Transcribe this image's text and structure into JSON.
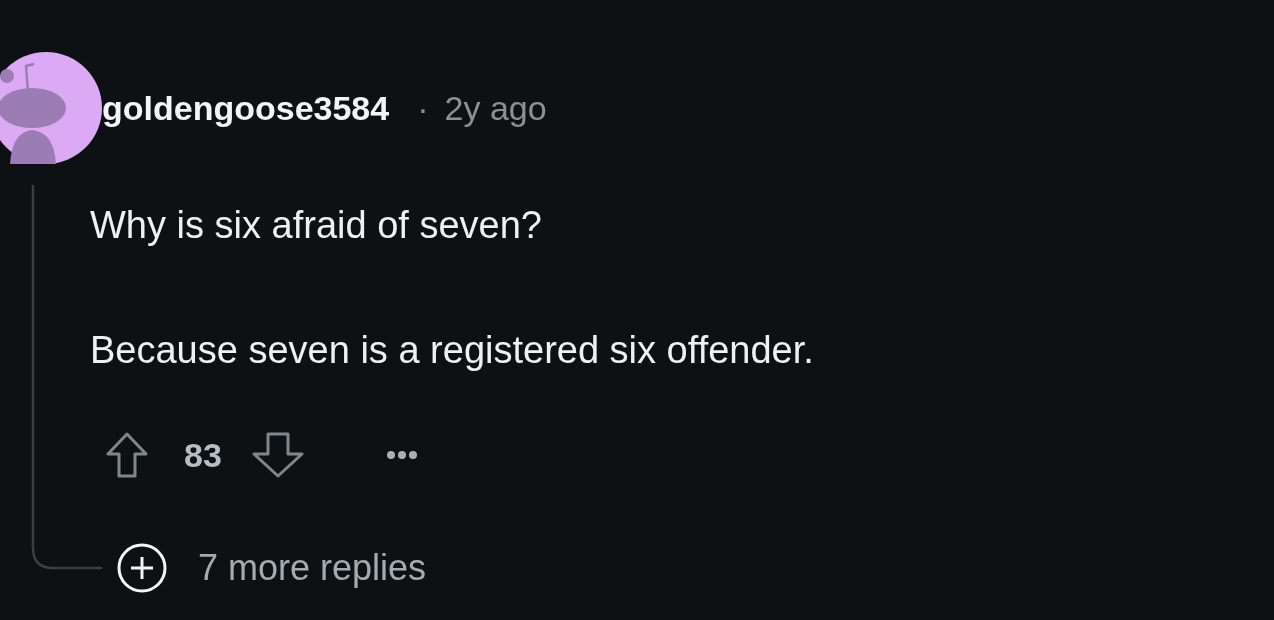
{
  "comment": {
    "author": "goldengoose3584",
    "separator": "·",
    "time": "2y ago",
    "body": [
      "Why is six afraid of seven?",
      "Because seven is a registered six offender."
    ],
    "score": "83",
    "replies": "7 more replies"
  }
}
